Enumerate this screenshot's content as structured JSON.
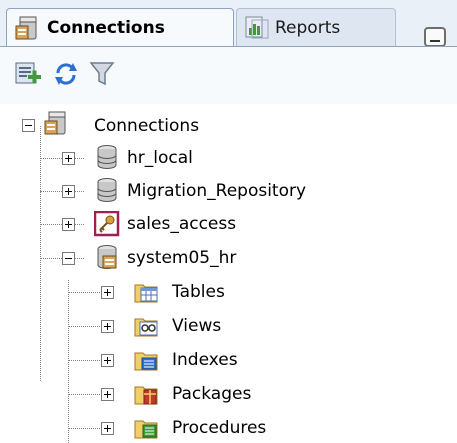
{
  "tabs": [
    {
      "label": "Connections",
      "icon": "connections-db-icon",
      "active": true
    },
    {
      "label": "Reports",
      "icon": "reports-icon",
      "active": false
    }
  ],
  "toolbar": {
    "buttons": [
      {
        "name": "new-connection-button",
        "icon": "add-connection-icon"
      },
      {
        "name": "refresh-button",
        "icon": "refresh-icon"
      },
      {
        "name": "filter-button",
        "icon": "filter-icon"
      }
    ]
  },
  "tree": {
    "root": {
      "label": "Connections",
      "icon": "connections-db-icon",
      "expanded": true
    },
    "connections": [
      {
        "label": "hr_local",
        "icon": "database-cylinder-icon",
        "expanded": false
      },
      {
        "label": "Migration_Repository",
        "icon": "database-cylinder-icon",
        "expanded": false
      },
      {
        "label": "sales_access",
        "icon": "key-icon",
        "expanded": false
      },
      {
        "label": "system05_hr",
        "icon": "connected-db-icon",
        "expanded": true
      }
    ],
    "children": [
      {
        "label": "Tables",
        "icon": "table-folder-icon"
      },
      {
        "label": "Views",
        "icon": "views-folder-icon"
      },
      {
        "label": "Indexes",
        "icon": "indexes-folder-icon"
      },
      {
        "label": "Packages",
        "icon": "packages-folder-icon"
      },
      {
        "label": "Procedures",
        "icon": "procedures-folder-icon"
      }
    ]
  },
  "colors": {
    "tab_border": "#8ea3bd",
    "active_tab_bg": "#f7fafd",
    "panel_band": "#eaf0f8",
    "accent_green": "#3f9a3a",
    "accent_blue": "#2f6fcf",
    "key_icon_border": "#9c2050"
  }
}
